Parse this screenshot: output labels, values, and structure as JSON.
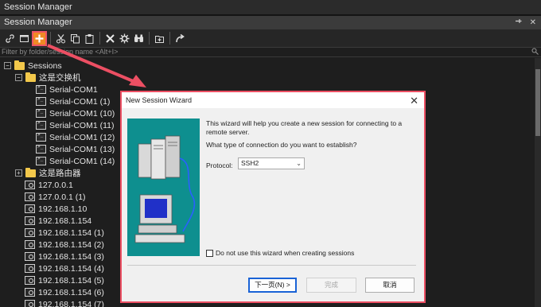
{
  "window": {
    "title": "Session Manager"
  },
  "panel": {
    "title": "Session Manager",
    "pin_glyph": "ᵖ",
    "close_glyph": "✕"
  },
  "toolbar": {
    "icons": [
      "link-icon",
      "window-icon",
      "new-session-icon",
      "cut-icon",
      "copy-icon",
      "paste-icon",
      "delete-icon",
      "properties-icon",
      "find-icon",
      "new-folder-icon",
      "connect-icon"
    ],
    "selected": "new-session-icon"
  },
  "filter": {
    "placeholder": "Filter by folder/session name <Alt+I>"
  },
  "tree": {
    "root": "Sessions",
    "folder1": "这是交换机",
    "folder1_items": [
      "Serial-COM1",
      "Serial-COM1 (1)",
      "Serial-COM1 (10)",
      "Serial-COM1 (11)",
      "Serial-COM1 (12)",
      "Serial-COM1 (13)",
      "Serial-COM1 (14)"
    ],
    "folder2": "这是路由器",
    "hosts": [
      "127.0.0.1",
      "127.0.0.1 (1)",
      "192.168.1.10",
      "192.168.1.154",
      "192.168.1.154 (1)",
      "192.168.1.154 (2)",
      "192.168.1.154 (3)",
      "192.168.1.154 (4)",
      "192.168.1.154 (5)",
      "192.168.1.154 (6)",
      "192.168.1.154 (7)"
    ],
    "expander_open": "−",
    "expander_closed": "+"
  },
  "dialog": {
    "title": "New Session Wizard",
    "close_glyph": "✕",
    "description": "This wizard will help you create a new session for connecting to a remote server.",
    "question": "What type of connection do you want to establish?",
    "protocol_label": "Protocol:",
    "protocol_value": "SSH2",
    "protocol_arrow": "⌄",
    "checkbox_label": "Do not use this wizard when creating sessions",
    "btn_next": "下一页(N) >",
    "btn_finish": "完成",
    "btn_cancel": "取消"
  },
  "colors": {
    "accent_annotation": "#ec4f63",
    "selected_tool": "#f08a24",
    "illustration_bg": "#0e8f8f"
  }
}
